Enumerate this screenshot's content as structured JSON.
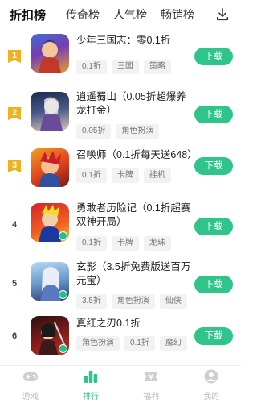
{
  "tabs": [
    {
      "label": "折扣榜",
      "active": true
    },
    {
      "label": "传奇榜",
      "active": false
    },
    {
      "label": "人气榜",
      "active": false
    },
    {
      "label": "畅销榜",
      "active": false
    }
  ],
  "games": [
    {
      "rank": "1",
      "title": "少年三国志：零0.1折",
      "tags": [
        "0.1折",
        "三国",
        "策略"
      ],
      "button": "下载"
    },
    {
      "rank": "2",
      "title": "逍遥蜀山（0.05折超爆养龙打金）",
      "tags": [
        "0.05折",
        "角色扮演"
      ],
      "button": "下载"
    },
    {
      "rank": "3",
      "title": "召唤师（0.1折每天送648）",
      "tags": [
        "0.1折",
        "卡牌",
        "挂机"
      ],
      "button": "下载"
    },
    {
      "rank": "4",
      "title": "勇敢者历险记（0.1折超赛双神开局）",
      "tags": [
        "0.1折",
        "卡牌",
        "龙珠"
      ],
      "button": "下载"
    },
    {
      "rank": "5",
      "title": "玄影（3.5折免费版送百万元宝）",
      "tags": [
        "3.5折",
        "角色扮演",
        "仙侠"
      ],
      "button": "下载"
    },
    {
      "rank": "6",
      "title": "真红之刃0.1折",
      "tags": [
        "角色扮演",
        "0.1折",
        "魔幻"
      ],
      "button": "下载"
    }
  ],
  "nav": [
    {
      "label": "游戏",
      "icon": "gamepad-icon",
      "active": false
    },
    {
      "label": "排行",
      "icon": "ranking-icon",
      "active": true
    },
    {
      "label": "福利",
      "icon": "gift-ticket-icon",
      "active": false
    },
    {
      "label": "我的",
      "icon": "user-icon",
      "active": false
    }
  ],
  "colors": {
    "accent": "#2fc489",
    "medal": "#f0b020"
  }
}
